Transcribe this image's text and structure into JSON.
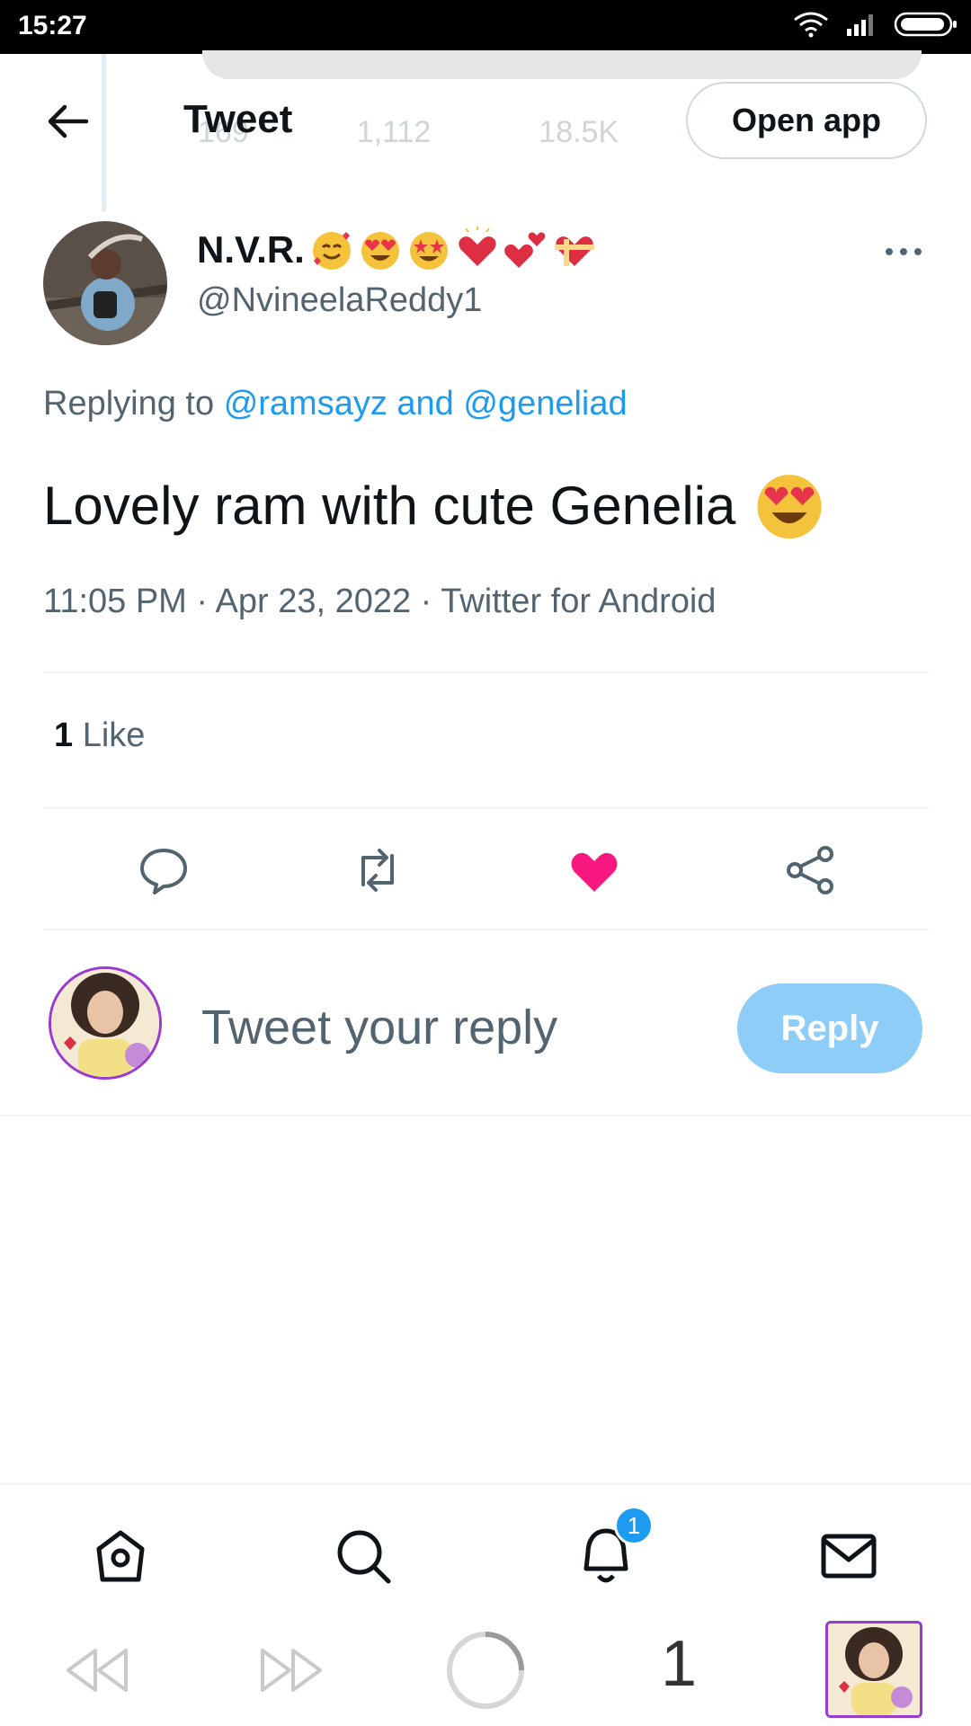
{
  "status_bar": {
    "time": "15:27",
    "battery_icon": "battery-icon",
    "wifi_icon": "wifi-icon",
    "signal_icon": "signal-icon"
  },
  "background_tweet": {
    "replies": "169",
    "retweets": "1,112",
    "likes": "18.5K"
  },
  "header": {
    "title": "Tweet",
    "open_app_label": "Open app",
    "back_icon": "back-arrow-icon"
  },
  "tweet": {
    "author_name": "N.V.R.",
    "author_emojis": [
      "smiling-face-with-hearts",
      "heart-eyes",
      "star-struck",
      "red-heart",
      "two-hearts",
      "heart-with-ribbon"
    ],
    "author_handle": "@NvineelaReddy1",
    "replying_prefix": "Replying to",
    "replying_mentions": "@ramsayz and @geneliad",
    "text": "Lovely ram with cute Genelia",
    "text_emoji": "heart-eyes",
    "time": "11:05 PM",
    "date": "Apr 23, 2022",
    "source": "Twitter for Android",
    "meta_line": "11:05 PM · Apr 23, 2022 · Twitter for Android",
    "like_count": "1",
    "like_label": "Like"
  },
  "actions": [
    "reply-icon",
    "retweet-icon",
    "heart-icon",
    "share-icon"
  ],
  "reply_composer": {
    "placeholder": "Tweet your reply",
    "button_label": "Reply"
  },
  "bottom_nav": {
    "items": [
      "home-icon",
      "search-icon",
      "bell-icon",
      "mail-icon"
    ],
    "notification_count": "1"
  },
  "browser_bar": {
    "tab_count": "1"
  },
  "colors": {
    "accent": "#1d9bf0",
    "like": "#f91880",
    "reply_button": "#8ecdf8",
    "text_secondary": "#536471"
  }
}
